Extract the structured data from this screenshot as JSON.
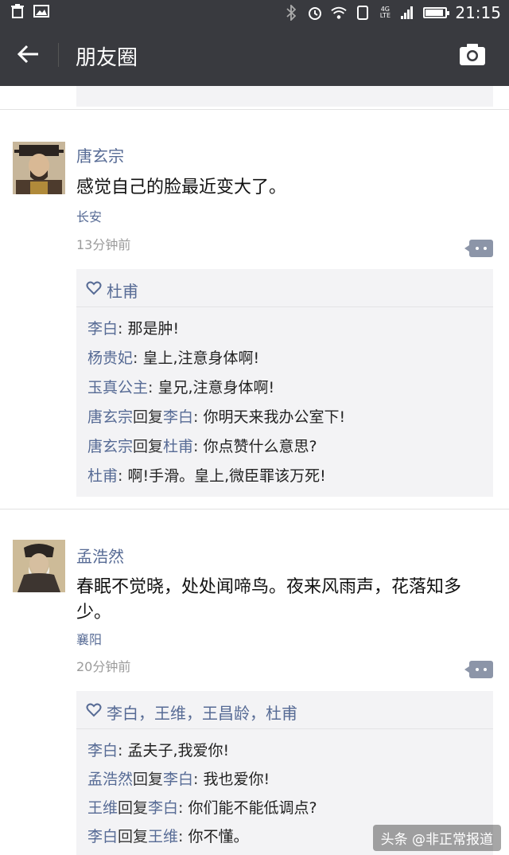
{
  "status_bar": {
    "time": "21:15",
    "network": "4G LTE"
  },
  "nav": {
    "title": "朋友圈"
  },
  "posts": [
    {
      "author": "唐玄宗",
      "text": "感觉自己的脸最近变大了。",
      "location": "长安",
      "time": "13分钟前",
      "likes": "杜甫",
      "comments": [
        {
          "name": "李白",
          "sep": ": ",
          "text": "那是肿!"
        },
        {
          "name": "杨贵妃",
          "sep": ": ",
          "text": "皇上,注意身体啊!"
        },
        {
          "name": "玉真公主",
          "sep": ": ",
          "text": "皇兄,注意身体啊!"
        },
        {
          "name": "唐玄宗",
          "reply_word": "回复",
          "reply_to": "李白",
          "sep": ": ",
          "text": "你明天来我办公室下!"
        },
        {
          "name": "唐玄宗",
          "reply_word": "回复",
          "reply_to": "杜甫",
          "sep": ": ",
          "text": "你点赞什么意思?"
        },
        {
          "name": "杜甫",
          "sep": ": ",
          "text": "啊!手滑。皇上,微臣罪该万死!"
        }
      ]
    },
    {
      "author": "孟浩然",
      "text": "春眠不觉晓，处处闻啼鸟。夜来风雨声，花落知多少。",
      "location": "襄阳",
      "time": "20分钟前",
      "likes": "李白，王维，王昌龄，杜甫",
      "comments": [
        {
          "name": "李白",
          "sep": ": ",
          "text": "孟夫子,我爱你!"
        },
        {
          "name": "孟浩然",
          "reply_word": "回复",
          "reply_to": "李白",
          "sep": ": ",
          "text": "我也爱你!"
        },
        {
          "name": "王维",
          "reply_word": "回复",
          "reply_to": "李白",
          "sep": ": ",
          "text": "你们能不能低调点?"
        },
        {
          "name": "李白",
          "reply_word": "回复",
          "reply_to": "王维",
          "sep": ": ",
          "text": "你不懂。"
        }
      ]
    }
  ],
  "watermark": "头条 @非正常报道",
  "colors": {
    "bar": "#393a3f",
    "link": "#576b95",
    "box": "#f3f3f5"
  }
}
